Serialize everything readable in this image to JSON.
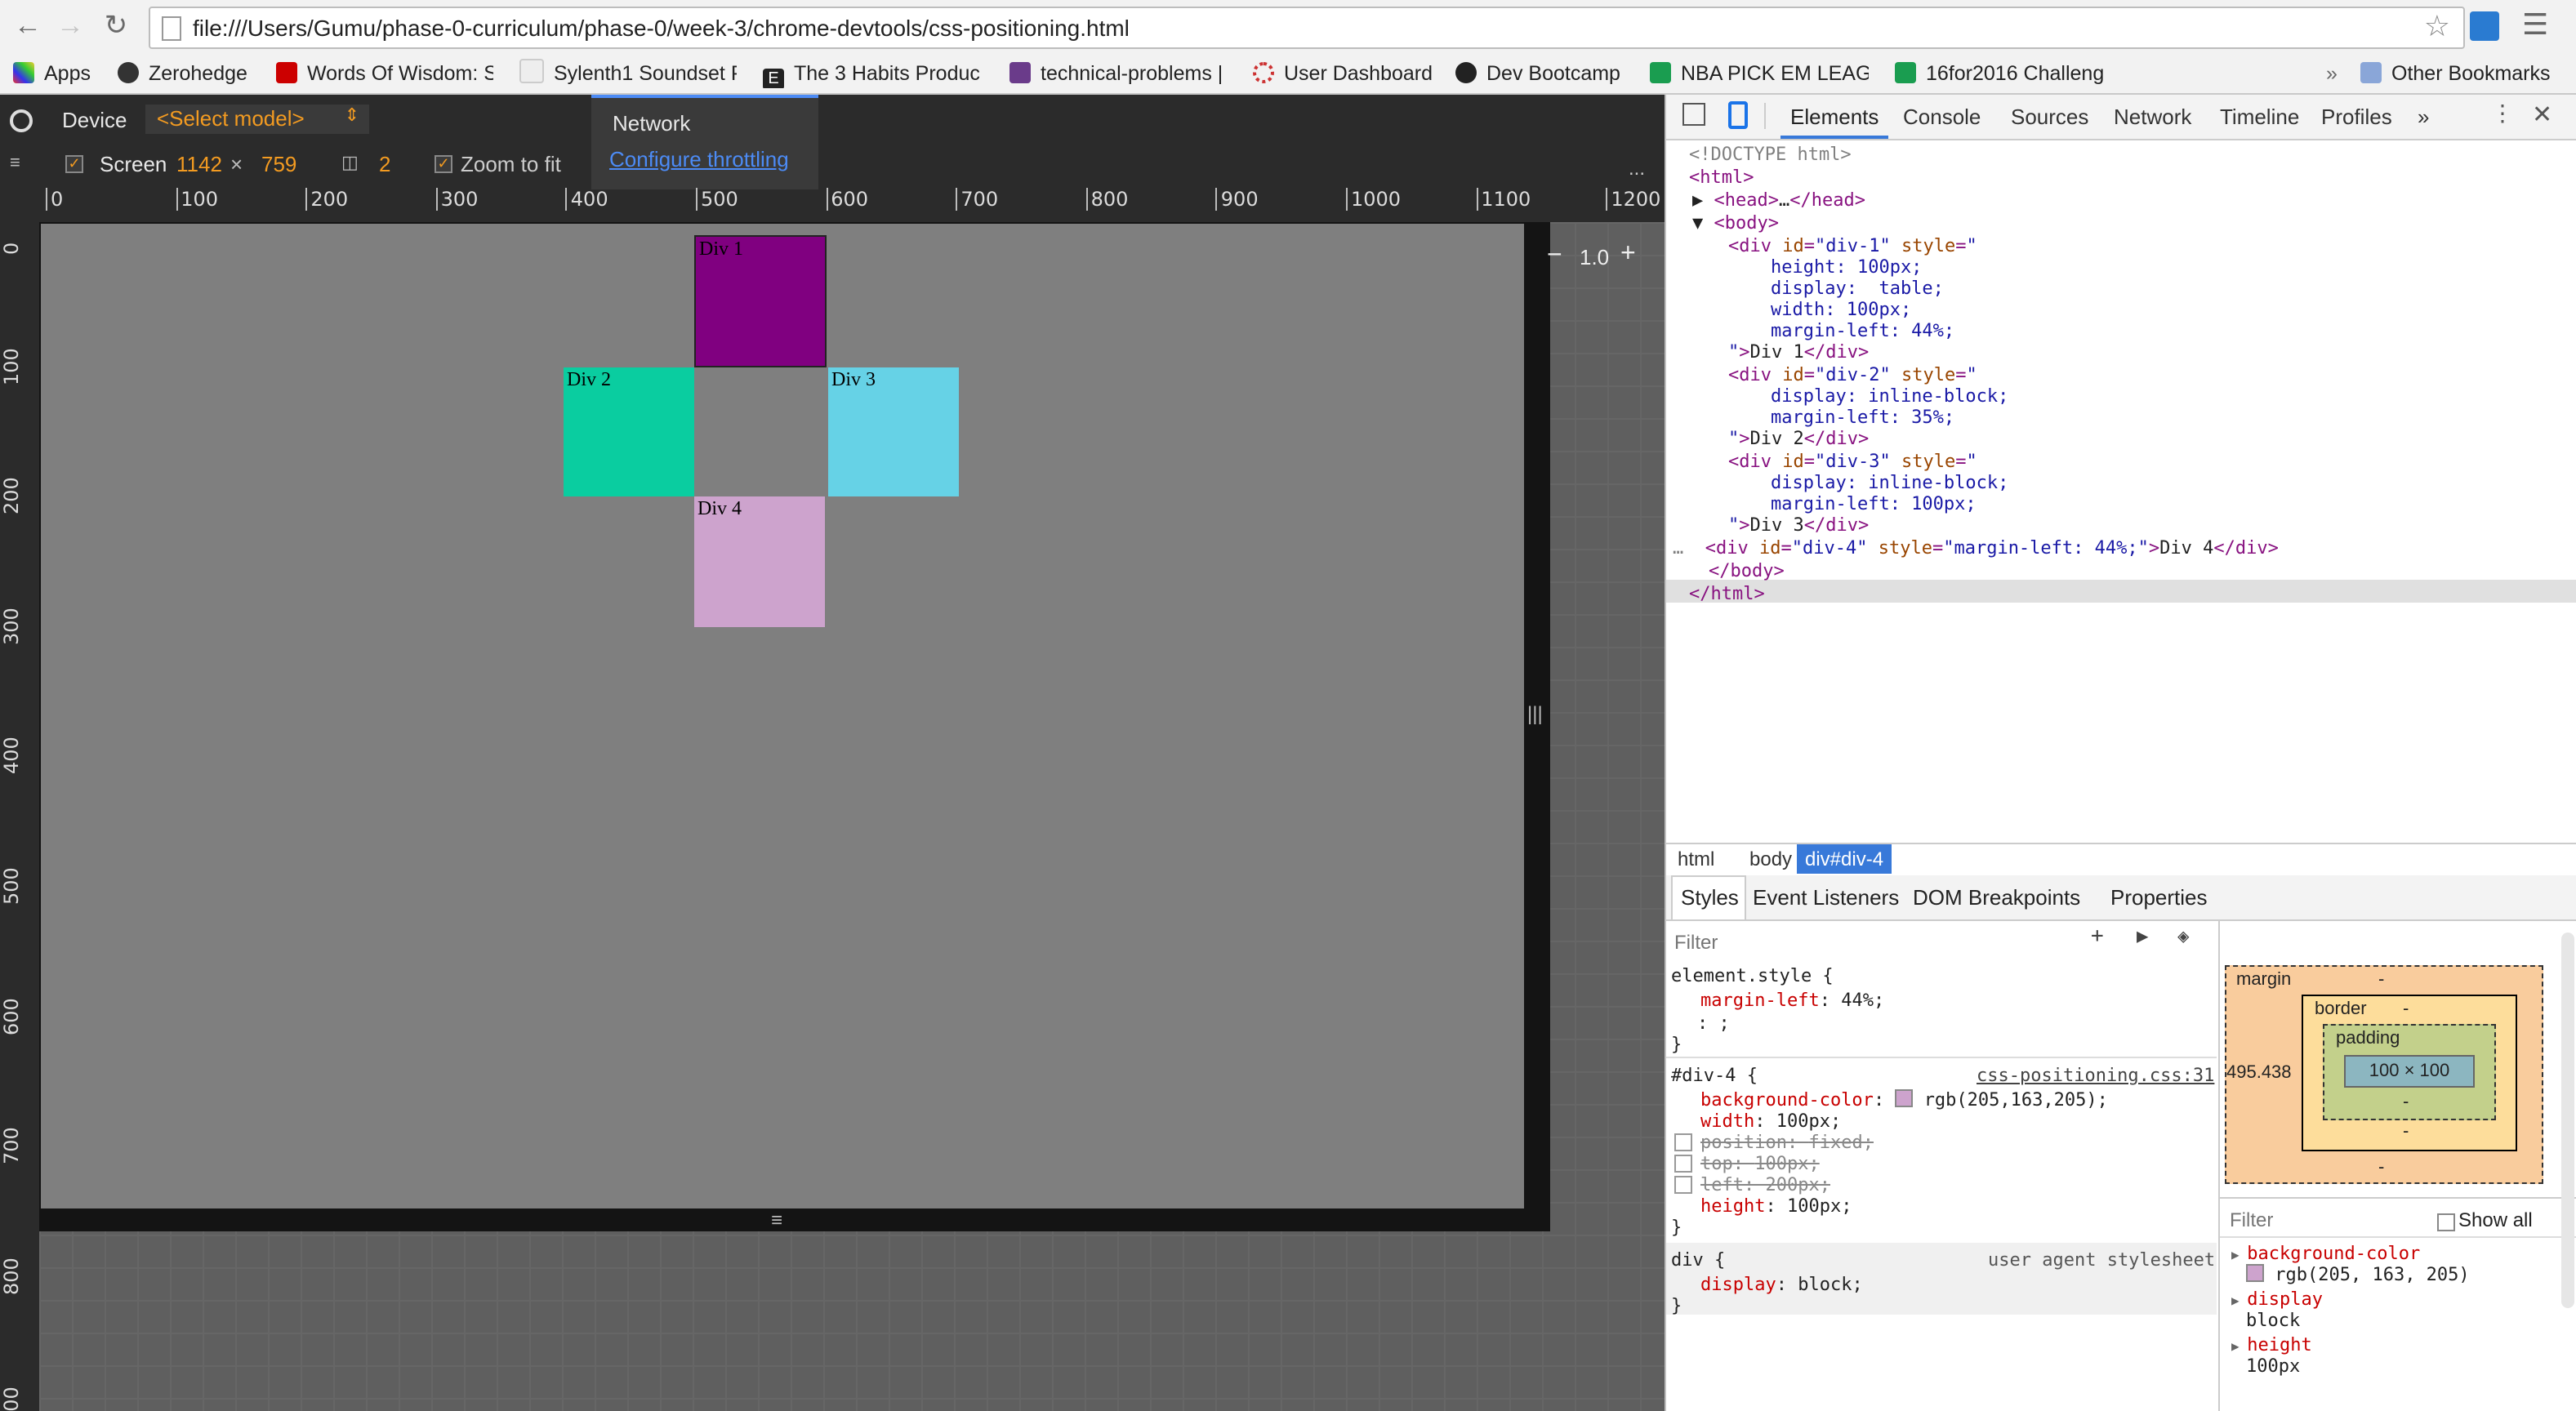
{
  "browser": {
    "url": "file:///Users/Gumu/phase-0-curriculum/phase-0/week-3/chrome-devtools/css-positioning.html",
    "bookmarks": [
      "Apps",
      "Zerohedge",
      "Words Of Wisdom: S",
      "Sylenth1 Soundset P",
      "The 3 Habits Produc",
      "technical-problems |",
      "User Dashboard",
      "Dev Bootcamp",
      "NBA PICK EM LEAGU",
      "16for2016 Challeng"
    ],
    "overflow": "»",
    "other_bookmarks": "Other Bookmarks"
  },
  "device_mode": {
    "device_label": "Device",
    "model_select": "<Select model>",
    "screen_label": "Screen",
    "width": "1142",
    "times": "×",
    "height": "759",
    "scale_value": "2",
    "zoom_to_fit": "Zoom to fit",
    "network_label": "Network",
    "throttling_link": "Configure throttling",
    "zoom_value": "1.0",
    "more": "...",
    "ruler_x": [
      "0",
      "100",
      "200",
      "300",
      "400",
      "500",
      "600",
      "700",
      "800",
      "900",
      "1000",
      "1100",
      "1200"
    ],
    "ruler_y": [
      "0",
      "100",
      "200",
      "300",
      "400",
      "500",
      "600",
      "700",
      "800",
      "900"
    ]
  },
  "page_boxes": [
    {
      "label": "Div 1",
      "color": "#800080"
    },
    {
      "label": "Div 2",
      "color": "#0acda0"
    },
    {
      "label": "Div 3",
      "color": "#66d2e6"
    },
    {
      "label": "Div 4",
      "color": "#cda3cd"
    }
  ],
  "devtools": {
    "tabs": [
      "Elements",
      "Console",
      "Sources",
      "Network",
      "Timeline",
      "Profiles"
    ],
    "more_tabs": "»",
    "breadcrumbs": [
      "html",
      "body",
      "div#div-4"
    ],
    "style_tabs": [
      "Styles",
      "Event Listeners",
      "DOM Breakpoints",
      "Properties"
    ],
    "filter_placeholder": "Filter",
    "metrics": {
      "margin_label": "margin",
      "border_label": "border",
      "padding_label": "padding",
      "content": "100 × 100",
      "margin_left": "495.438",
      "dash": "-"
    },
    "computed": {
      "filter_placeholder": "Filter",
      "show_all": "Show all",
      "items": [
        {
          "prop": "background-color",
          "value": "rgb(205, 163, 205)"
        },
        {
          "prop": "display",
          "value": "block"
        },
        {
          "prop": "height",
          "value": "100px"
        }
      ]
    },
    "css": {
      "element_style_selector": "element.style {",
      "element_style_prop": "margin-left",
      "element_style_val": "44%;",
      "editing": ": ;",
      "div4_selector": "#div-4 {",
      "div4_source": "css-positioning.css:31",
      "div4_props": [
        {
          "prop": "background-color",
          "val": "rgb(205,163,205);",
          "disabled": false,
          "swatch": "#cda3cd"
        },
        {
          "prop": "width",
          "val": "100px;",
          "disabled": false
        },
        {
          "prop": "position",
          "val": "fixed;",
          "disabled": true
        },
        {
          "prop": "top",
          "val": "100px;",
          "disabled": true
        },
        {
          "prop": "left",
          "val": "200px;",
          "disabled": true
        },
        {
          "prop": "height",
          "val": "100px;",
          "disabled": false
        }
      ],
      "ua_selector": "div {",
      "ua_source": "user agent stylesheet",
      "ua_prop": "display",
      "ua_val": "block;",
      "close": "}"
    }
  }
}
